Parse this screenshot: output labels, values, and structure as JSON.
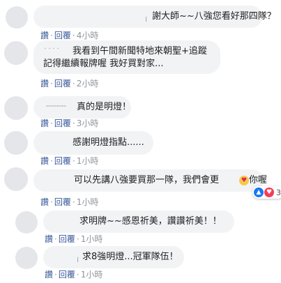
{
  "action_labels": {
    "like": "讚",
    "reply": "回覆",
    "separator": "·"
  },
  "comments": [
    {
      "text": "謝大師~~八強您看好那四隊？",
      "time": "4小時"
    },
    {
      "text_line1": "我看到午間新聞特地來朝聖+追蹤",
      "text_line2": "記得繼續報牌喔 我好買對家...",
      "time": "2小時"
    },
    {
      "text": "真的是明燈！",
      "time": "3小時"
    },
    {
      "text": "感謝明燈指點......",
      "time": "1小時"
    },
    {
      "text": "可以先講八強要買那一隊，我們會更",
      "text_suffix": "你喔",
      "time": "1小時",
      "reactions_count": "3"
    },
    {
      "text": "求明牌~~感恩祈美，讚讚祈美！！",
      "time": "1小時"
    },
    {
      "text": "求8強明燈...冠軍隊伍！",
      "time": "1小時"
    }
  ]
}
